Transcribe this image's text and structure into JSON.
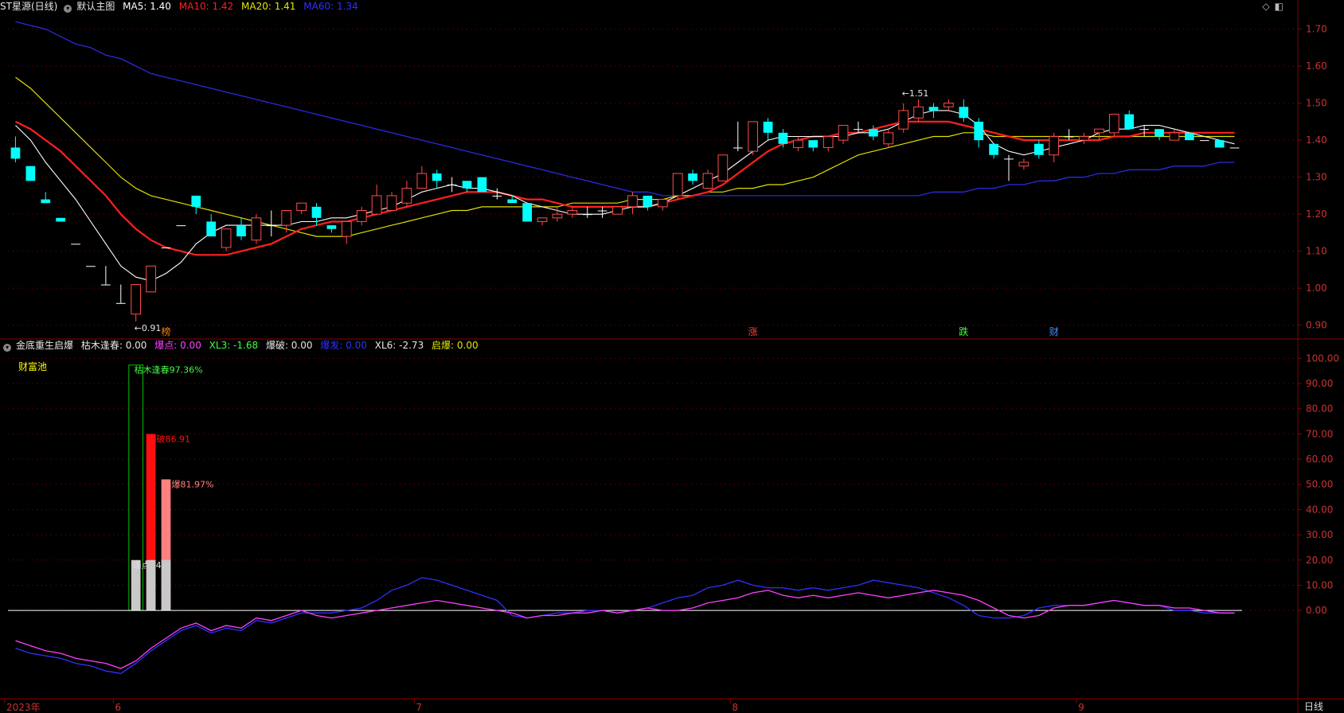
{
  "main_header": {
    "stock": "ST星源(日线)",
    "template": "默认主图",
    "ma5": "MA5: 1.40",
    "ma10": "MA10: 1.42",
    "ma20": "MA20: 1.41",
    "ma60": "MA60: 1.34"
  },
  "sub_header": {
    "indicator": "金底重生启爆",
    "kmfc": "枯木逢春: 0.00",
    "bd": "爆点: 0.00",
    "xl3": "XL3: -1.68",
    "bp": "爆破: 0.00",
    "bf": "爆发: 0.00",
    "xl6": "XL6: -2.73",
    "qb": "启爆: 0.00"
  },
  "pool_label": "财富池",
  "period_button": "日线",
  "colors": {
    "up": "#ff4d4d",
    "down": "#00ffff",
    "ma5": "#ffffff",
    "ma10": "#ff2020",
    "ma20": "#e0e000",
    "ma60": "#2a2ae0",
    "xl_a": "#ff3fff",
    "xl_b": "#3030ff",
    "grid": "#8b0000"
  },
  "chart_data": [
    {
      "type": "candlestick",
      "title": "ST星源(日线)",
      "ylim": [
        0.88,
        1.74
      ],
      "y_ticks": [
        "1.70",
        "1.60",
        "1.50",
        "1.40",
        "1.30",
        "1.20",
        "1.10",
        "1.00",
        "0.90"
      ],
      "x_ticks": [
        "2023年",
        "6",
        "7",
        "8",
        "9"
      ],
      "x_tick_index": [
        0,
        7,
        27,
        48,
        71
      ],
      "annotations": [
        {
          "text": "←0.91",
          "index": 8,
          "value": 0.91
        },
        {
          "text": "←1.51",
          "index": 59,
          "value": 1.51
        }
      ],
      "markers": [
        {
          "text": "榜",
          "index": 10,
          "color": "#ff8000"
        },
        {
          "text": "涨",
          "index": 49,
          "color": "#ff4040"
        },
        {
          "text": "跌",
          "index": 63,
          "color": "#40ff40"
        },
        {
          "text": "财",
          "index": 69,
          "color": "#4090ff"
        }
      ],
      "candles": [
        [
          1.38,
          1.35,
          1.41,
          1.34
        ],
        [
          1.33,
          1.29,
          1.33,
          1.29
        ],
        [
          1.24,
          1.23,
          1.26,
          1.23
        ],
        [
          1.19,
          1.18,
          1.19,
          1.18
        ],
        [
          1.12,
          1.12,
          1.12,
          1.12
        ],
        [
          1.06,
          1.06,
          1.06,
          1.06
        ],
        [
          1.01,
          1.01,
          1.06,
          1.01
        ],
        [
          0.96,
          0.96,
          1.01,
          0.96
        ],
        [
          0.93,
          1.01,
          1.01,
          0.91
        ],
        [
          0.99,
          1.06,
          1.06,
          0.99
        ],
        [
          1.11,
          1.11,
          1.11,
          1.11
        ],
        [
          1.17,
          1.17,
          1.17,
          1.17
        ],
        [
          1.25,
          1.22,
          1.25,
          1.2
        ],
        [
          1.18,
          1.14,
          1.2,
          1.14
        ],
        [
          1.11,
          1.16,
          1.16,
          1.1
        ],
        [
          1.17,
          1.14,
          1.19,
          1.13
        ],
        [
          1.13,
          1.19,
          1.2,
          1.12
        ],
        [
          1.17,
          1.17,
          1.21,
          1.14
        ],
        [
          1.17,
          1.21,
          1.21,
          1.15
        ],
        [
          1.21,
          1.23,
          1.23,
          1.2
        ],
        [
          1.22,
          1.19,
          1.23,
          1.17
        ],
        [
          1.17,
          1.16,
          1.17,
          1.15
        ],
        [
          1.14,
          1.18,
          1.18,
          1.12
        ],
        [
          1.18,
          1.21,
          1.22,
          1.17
        ],
        [
          1.2,
          1.25,
          1.28,
          1.2
        ],
        [
          1.21,
          1.25,
          1.26,
          1.21
        ],
        [
          1.23,
          1.27,
          1.29,
          1.22
        ],
        [
          1.27,
          1.31,
          1.33,
          1.27
        ],
        [
          1.31,
          1.29,
          1.32,
          1.27
        ],
        [
          1.28,
          1.28,
          1.3,
          1.26
        ],
        [
          1.29,
          1.27,
          1.29,
          1.26
        ],
        [
          1.3,
          1.26,
          1.3,
          1.26
        ],
        [
          1.25,
          1.25,
          1.27,
          1.24
        ],
        [
          1.24,
          1.23,
          1.25,
          1.23
        ],
        [
          1.23,
          1.18,
          1.23,
          1.18
        ],
        [
          1.18,
          1.19,
          1.19,
          1.17
        ],
        [
          1.19,
          1.2,
          1.22,
          1.18
        ],
        [
          1.2,
          1.21,
          1.22,
          1.19
        ],
        [
          1.2,
          1.2,
          1.22,
          1.19
        ],
        [
          1.21,
          1.21,
          1.22,
          1.19
        ],
        [
          1.2,
          1.22,
          1.22,
          1.2
        ],
        [
          1.22,
          1.25,
          1.26,
          1.2
        ],
        [
          1.25,
          1.22,
          1.25,
          1.21
        ],
        [
          1.22,
          1.24,
          1.24,
          1.21
        ],
        [
          1.25,
          1.31,
          1.31,
          1.24
        ],
        [
          1.31,
          1.29,
          1.32,
          1.28
        ],
        [
          1.27,
          1.31,
          1.32,
          1.27
        ],
        [
          1.29,
          1.36,
          1.36,
          1.29
        ],
        [
          1.38,
          1.38,
          1.45,
          1.37
        ],
        [
          1.37,
          1.45,
          1.45,
          1.36
        ],
        [
          1.45,
          1.42,
          1.46,
          1.4
        ],
        [
          1.42,
          1.39,
          1.43,
          1.38
        ],
        [
          1.38,
          1.4,
          1.41,
          1.37
        ],
        [
          1.4,
          1.38,
          1.4,
          1.37
        ],
        [
          1.38,
          1.41,
          1.41,
          1.37
        ],
        [
          1.4,
          1.44,
          1.44,
          1.39
        ],
        [
          1.43,
          1.43,
          1.45,
          1.42
        ],
        [
          1.43,
          1.41,
          1.44,
          1.4
        ],
        [
          1.39,
          1.42,
          1.43,
          1.38
        ],
        [
          1.43,
          1.48,
          1.5,
          1.42
        ],
        [
          1.46,
          1.49,
          1.51,
          1.45
        ],
        [
          1.49,
          1.48,
          1.5,
          1.46
        ],
        [
          1.49,
          1.5,
          1.51,
          1.48
        ],
        [
          1.49,
          1.46,
          1.51,
          1.45
        ],
        [
          1.45,
          1.4,
          1.46,
          1.38
        ],
        [
          1.39,
          1.36,
          1.39,
          1.35
        ],
        [
          1.35,
          1.35,
          1.36,
          1.29
        ],
        [
          1.33,
          1.34,
          1.35,
          1.32
        ],
        [
          1.39,
          1.36,
          1.4,
          1.35
        ],
        [
          1.36,
          1.41,
          1.42,
          1.34
        ],
        [
          1.41,
          1.41,
          1.43,
          1.4
        ],
        [
          1.4,
          1.41,
          1.42,
          1.39
        ],
        [
          1.42,
          1.43,
          1.43,
          1.4
        ],
        [
          1.42,
          1.47,
          1.47,
          1.41
        ],
        [
          1.47,
          1.43,
          1.48,
          1.43
        ],
        [
          1.43,
          1.43,
          1.44,
          1.41
        ],
        [
          1.43,
          1.41,
          1.43,
          1.4
        ],
        [
          1.4,
          1.42,
          1.43,
          1.4
        ],
        [
          1.42,
          1.4,
          1.42,
          1.4
        ],
        [
          1.4,
          1.4,
          1.4,
          1.4
        ],
        [
          1.4,
          1.38,
          1.4,
          1.38
        ],
        [
          1.38,
          1.38,
          1.38,
          1.38
        ]
      ],
      "ma5": [
        1.44,
        1.4,
        1.34,
        1.29,
        1.24,
        1.18,
        1.12,
        1.06,
        1.03,
        1.02,
        1.04,
        1.07,
        1.12,
        1.15,
        1.17,
        1.17,
        1.17,
        1.17,
        1.17,
        1.18,
        1.18,
        1.19,
        1.19,
        1.2,
        1.21,
        1.22,
        1.24,
        1.26,
        1.27,
        1.28,
        1.27,
        1.27,
        1.26,
        1.25,
        1.23,
        1.22,
        1.21,
        1.2,
        1.2,
        1.2,
        1.21,
        1.22,
        1.22,
        1.23,
        1.25,
        1.27,
        1.29,
        1.31,
        1.34,
        1.37,
        1.4,
        1.41,
        1.41,
        1.41,
        1.41,
        1.41,
        1.42,
        1.42,
        1.43,
        1.45,
        1.47,
        1.48,
        1.48,
        1.47,
        1.44,
        1.39,
        1.37,
        1.36,
        1.37,
        1.38,
        1.39,
        1.4,
        1.42,
        1.43,
        1.43,
        1.44,
        1.44,
        1.43,
        1.42,
        1.41,
        1.4,
        1.39
      ],
      "ma10": [
        1.45,
        1.43,
        1.4,
        1.37,
        1.33,
        1.29,
        1.25,
        1.2,
        1.16,
        1.13,
        1.11,
        1.1,
        1.09,
        1.09,
        1.09,
        1.1,
        1.11,
        1.12,
        1.14,
        1.16,
        1.17,
        1.18,
        1.18,
        1.19,
        1.2,
        1.21,
        1.22,
        1.23,
        1.24,
        1.25,
        1.26,
        1.26,
        1.26,
        1.25,
        1.24,
        1.24,
        1.23,
        1.22,
        1.22,
        1.22,
        1.22,
        1.22,
        1.22,
        1.23,
        1.24,
        1.25,
        1.26,
        1.28,
        1.31,
        1.34,
        1.37,
        1.39,
        1.4,
        1.41,
        1.41,
        1.42,
        1.42,
        1.43,
        1.44,
        1.45,
        1.45,
        1.45,
        1.45,
        1.44,
        1.43,
        1.42,
        1.41,
        1.4,
        1.4,
        1.4,
        1.4,
        1.4,
        1.4,
        1.41,
        1.41,
        1.42,
        1.42,
        1.42,
        1.42,
        1.42,
        1.42,
        1.42
      ],
      "ma20": [
        1.57,
        1.54,
        1.5,
        1.46,
        1.42,
        1.38,
        1.34,
        1.3,
        1.27,
        1.25,
        1.24,
        1.23,
        1.22,
        1.21,
        1.2,
        1.19,
        1.18,
        1.17,
        1.16,
        1.15,
        1.14,
        1.14,
        1.14,
        1.15,
        1.16,
        1.17,
        1.18,
        1.19,
        1.2,
        1.21,
        1.21,
        1.22,
        1.22,
        1.22,
        1.22,
        1.22,
        1.22,
        1.23,
        1.23,
        1.23,
        1.23,
        1.24,
        1.24,
        1.24,
        1.25,
        1.25,
        1.26,
        1.26,
        1.27,
        1.27,
        1.28,
        1.28,
        1.29,
        1.3,
        1.32,
        1.34,
        1.36,
        1.37,
        1.38,
        1.39,
        1.4,
        1.41,
        1.41,
        1.42,
        1.42,
        1.41,
        1.41,
        1.41,
        1.41,
        1.41,
        1.41,
        1.41,
        1.41,
        1.41,
        1.41,
        1.41,
        1.41,
        1.41,
        1.41,
        1.41,
        1.41,
        1.41
      ],
      "ma60": [
        1.72,
        1.71,
        1.7,
        1.68,
        1.66,
        1.65,
        1.63,
        1.62,
        1.6,
        1.58,
        1.57,
        1.56,
        1.55,
        1.54,
        1.53,
        1.52,
        1.51,
        1.5,
        1.49,
        1.48,
        1.47,
        1.46,
        1.45,
        1.44,
        1.43,
        1.42,
        1.41,
        1.4,
        1.39,
        1.38,
        1.37,
        1.36,
        1.35,
        1.34,
        1.33,
        1.32,
        1.31,
        1.3,
        1.29,
        1.28,
        1.27,
        1.26,
        1.26,
        1.25,
        1.25,
        1.25,
        1.25,
        1.25,
        1.25,
        1.25,
        1.25,
        1.25,
        1.25,
        1.25,
        1.25,
        1.25,
        1.25,
        1.25,
        1.25,
        1.25,
        1.25,
        1.26,
        1.26,
        1.26,
        1.27,
        1.27,
        1.28,
        1.28,
        1.29,
        1.29,
        1.3,
        1.3,
        1.31,
        1.31,
        1.32,
        1.32,
        1.32,
        1.33,
        1.33,
        1.33,
        1.34,
        1.34
      ]
    },
    {
      "type": "bar+line",
      "title": "金底重生启爆",
      "ylim": [
        -35,
        102
      ],
      "y_ticks": [
        "100.00",
        "90.00",
        "80.00",
        "70.00",
        "60.00",
        "50.00",
        "40.00",
        "30.00",
        "20.00",
        "10.00",
        "0.00"
      ],
      "bars": [
        {
          "label": "枯木逢春97.36%",
          "index": 8,
          "value": 97.36,
          "color": "#00c000",
          "outline": true
        },
        {
          "label": "爆破86.91",
          "index": 9,
          "value": 70,
          "color": "#ff1010"
        },
        {
          "label": "启爆81.97%",
          "index": 10,
          "value": 52,
          "color": "#ff8080"
        },
        {
          "label": "爆点64%",
          "index": 8,
          "value": 20,
          "color": "#c8c8c8"
        },
        {
          "label": "",
          "index": 9,
          "value": 20,
          "color": "#c8c8c8"
        },
        {
          "label": "",
          "index": 10,
          "value": 20,
          "color": "#c8c8c8"
        }
      ],
      "xl3": [
        -12,
        -14,
        -16,
        -17,
        -19,
        -20,
        -21,
        -23,
        -20,
        -15,
        -11,
        -7,
        -5,
        -8,
        -6,
        -7,
        -3,
        -4,
        -2,
        0,
        -2,
        -3,
        -2,
        -1,
        0,
        1,
        2,
        3,
        4,
        3,
        2,
        1,
        0,
        -1,
        -3,
        -2,
        -2,
        -1,
        -1,
        0,
        -1,
        0,
        1,
        0,
        0,
        1,
        3,
        4,
        5,
        7,
        8,
        6,
        5,
        6,
        5,
        6,
        7,
        6,
        5,
        6,
        7,
        8,
        7,
        6,
        4,
        1,
        -2,
        -3,
        -2,
        1,
        2,
        2,
        3,
        4,
        3,
        2,
        2,
        1,
        1,
        0,
        -1,
        -1
      ],
      "xl6": [
        -15,
        -17,
        -18,
        -19,
        -21,
        -22,
        -24,
        -25,
        -21,
        -16,
        -12,
        -8,
        -6,
        -9,
        -7,
        -8,
        -4,
        -5,
        -3,
        -1,
        -1,
        -1,
        0,
        1,
        4,
        8,
        10,
        13,
        12,
        10,
        8,
        6,
        4,
        -2,
        -3,
        -2,
        -1,
        -1,
        0,
        0,
        -1,
        0,
        1,
        3,
        5,
        6,
        9,
        10,
        12,
        10,
        9,
        9,
        8,
        9,
        8,
        9,
        10,
        12,
        11,
        10,
        9,
        7,
        5,
        2,
        -2,
        -3,
        -3,
        -2,
        1,
        2,
        2,
        2,
        3,
        4,
        3,
        2,
        2,
        0,
        0,
        -1,
        -1,
        -1
      ]
    }
  ]
}
